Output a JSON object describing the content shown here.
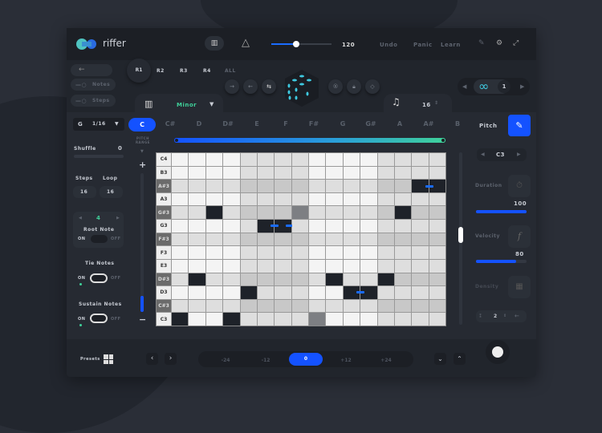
{
  "app": {
    "name": "riffer",
    "tempo": "120",
    "tempo_fraction": 0.45,
    "undo": "Undo",
    "panic": "Panic",
    "learn": "Learn"
  },
  "left_toggles": {
    "notes": "Notes",
    "steps": "Steps"
  },
  "rows": [
    "R1",
    "R2",
    "R3",
    "R4",
    "ALL"
  ],
  "scale": {
    "name": "Minor"
  },
  "steps_select": "16",
  "loop": {
    "value": "1"
  },
  "settings": {
    "grid_key": "G",
    "division": "1/16",
    "shuffle_label": "Shuffle",
    "shuffle_value": "0",
    "steps_label": "Steps",
    "loop_label": "Loop",
    "steps": "16",
    "loop": "16",
    "root_value": "4",
    "root_label": "Root Note",
    "on": "ON",
    "off": "OFF",
    "tie_label": "Tie Notes",
    "sustain_label": "Sustain Notes"
  },
  "keys": [
    "C",
    "C#",
    "D",
    "D#",
    "E",
    "F",
    "F#",
    "G",
    "G#",
    "A",
    "A#",
    "B"
  ],
  "selected_key": "C",
  "pitch_label": "Pitch",
  "pitch_range_label": "PITCH RANGE",
  "plus": "+",
  "minus": "−",
  "note_rows": [
    "C4",
    "B3",
    "A#3",
    "A3",
    "G#3",
    "G3",
    "F#3",
    "F3",
    "E3",
    "D#3",
    "D3",
    "C#3",
    "C3"
  ],
  "black_rows": [
    "A#3",
    "G#3",
    "F#3",
    "D#3",
    "C#3"
  ],
  "notes": [
    {
      "row": "A#3",
      "cols": [
        14,
        15
      ]
    },
    {
      "row": "G#3",
      "cols": [
        2
      ]
    },
    {
      "row": "G#3",
      "cols": [
        13
      ]
    },
    {
      "row": "G3",
      "cols": [
        5,
        6
      ]
    },
    {
      "row": "D#3",
      "cols": [
        1
      ]
    },
    {
      "row": "D#3",
      "cols": [
        9
      ]
    },
    {
      "row": "D#3",
      "cols": [
        12
      ]
    },
    {
      "row": "D3",
      "cols": [
        4
      ]
    },
    {
      "row": "D3",
      "cols": [
        10,
        11
      ]
    },
    {
      "row": "C3",
      "cols": [
        0
      ]
    },
    {
      "row": "C3",
      "cols": [
        3
      ]
    }
  ],
  "muted": [
    {
      "row": "G#3",
      "col": 7
    },
    {
      "row": "C3",
      "col": 8
    }
  ],
  "right": {
    "note": "C3",
    "duration_label": "Duration",
    "duration": "100",
    "duration_fraction": 1.0,
    "velocity_label": "Velocity",
    "velocity": "80",
    "velocity_fraction": 0.8,
    "density_label": "Density",
    "density_value": "2"
  },
  "bottom": {
    "presets": "Presets",
    "transpose": [
      "-24",
      "-12",
      "0",
      "+12",
      "+24"
    ],
    "transpose_selected": "0"
  },
  "colors": {
    "accent": "#1452ff",
    "teal": "#3ec9e0",
    "green": "#3fd19a"
  }
}
